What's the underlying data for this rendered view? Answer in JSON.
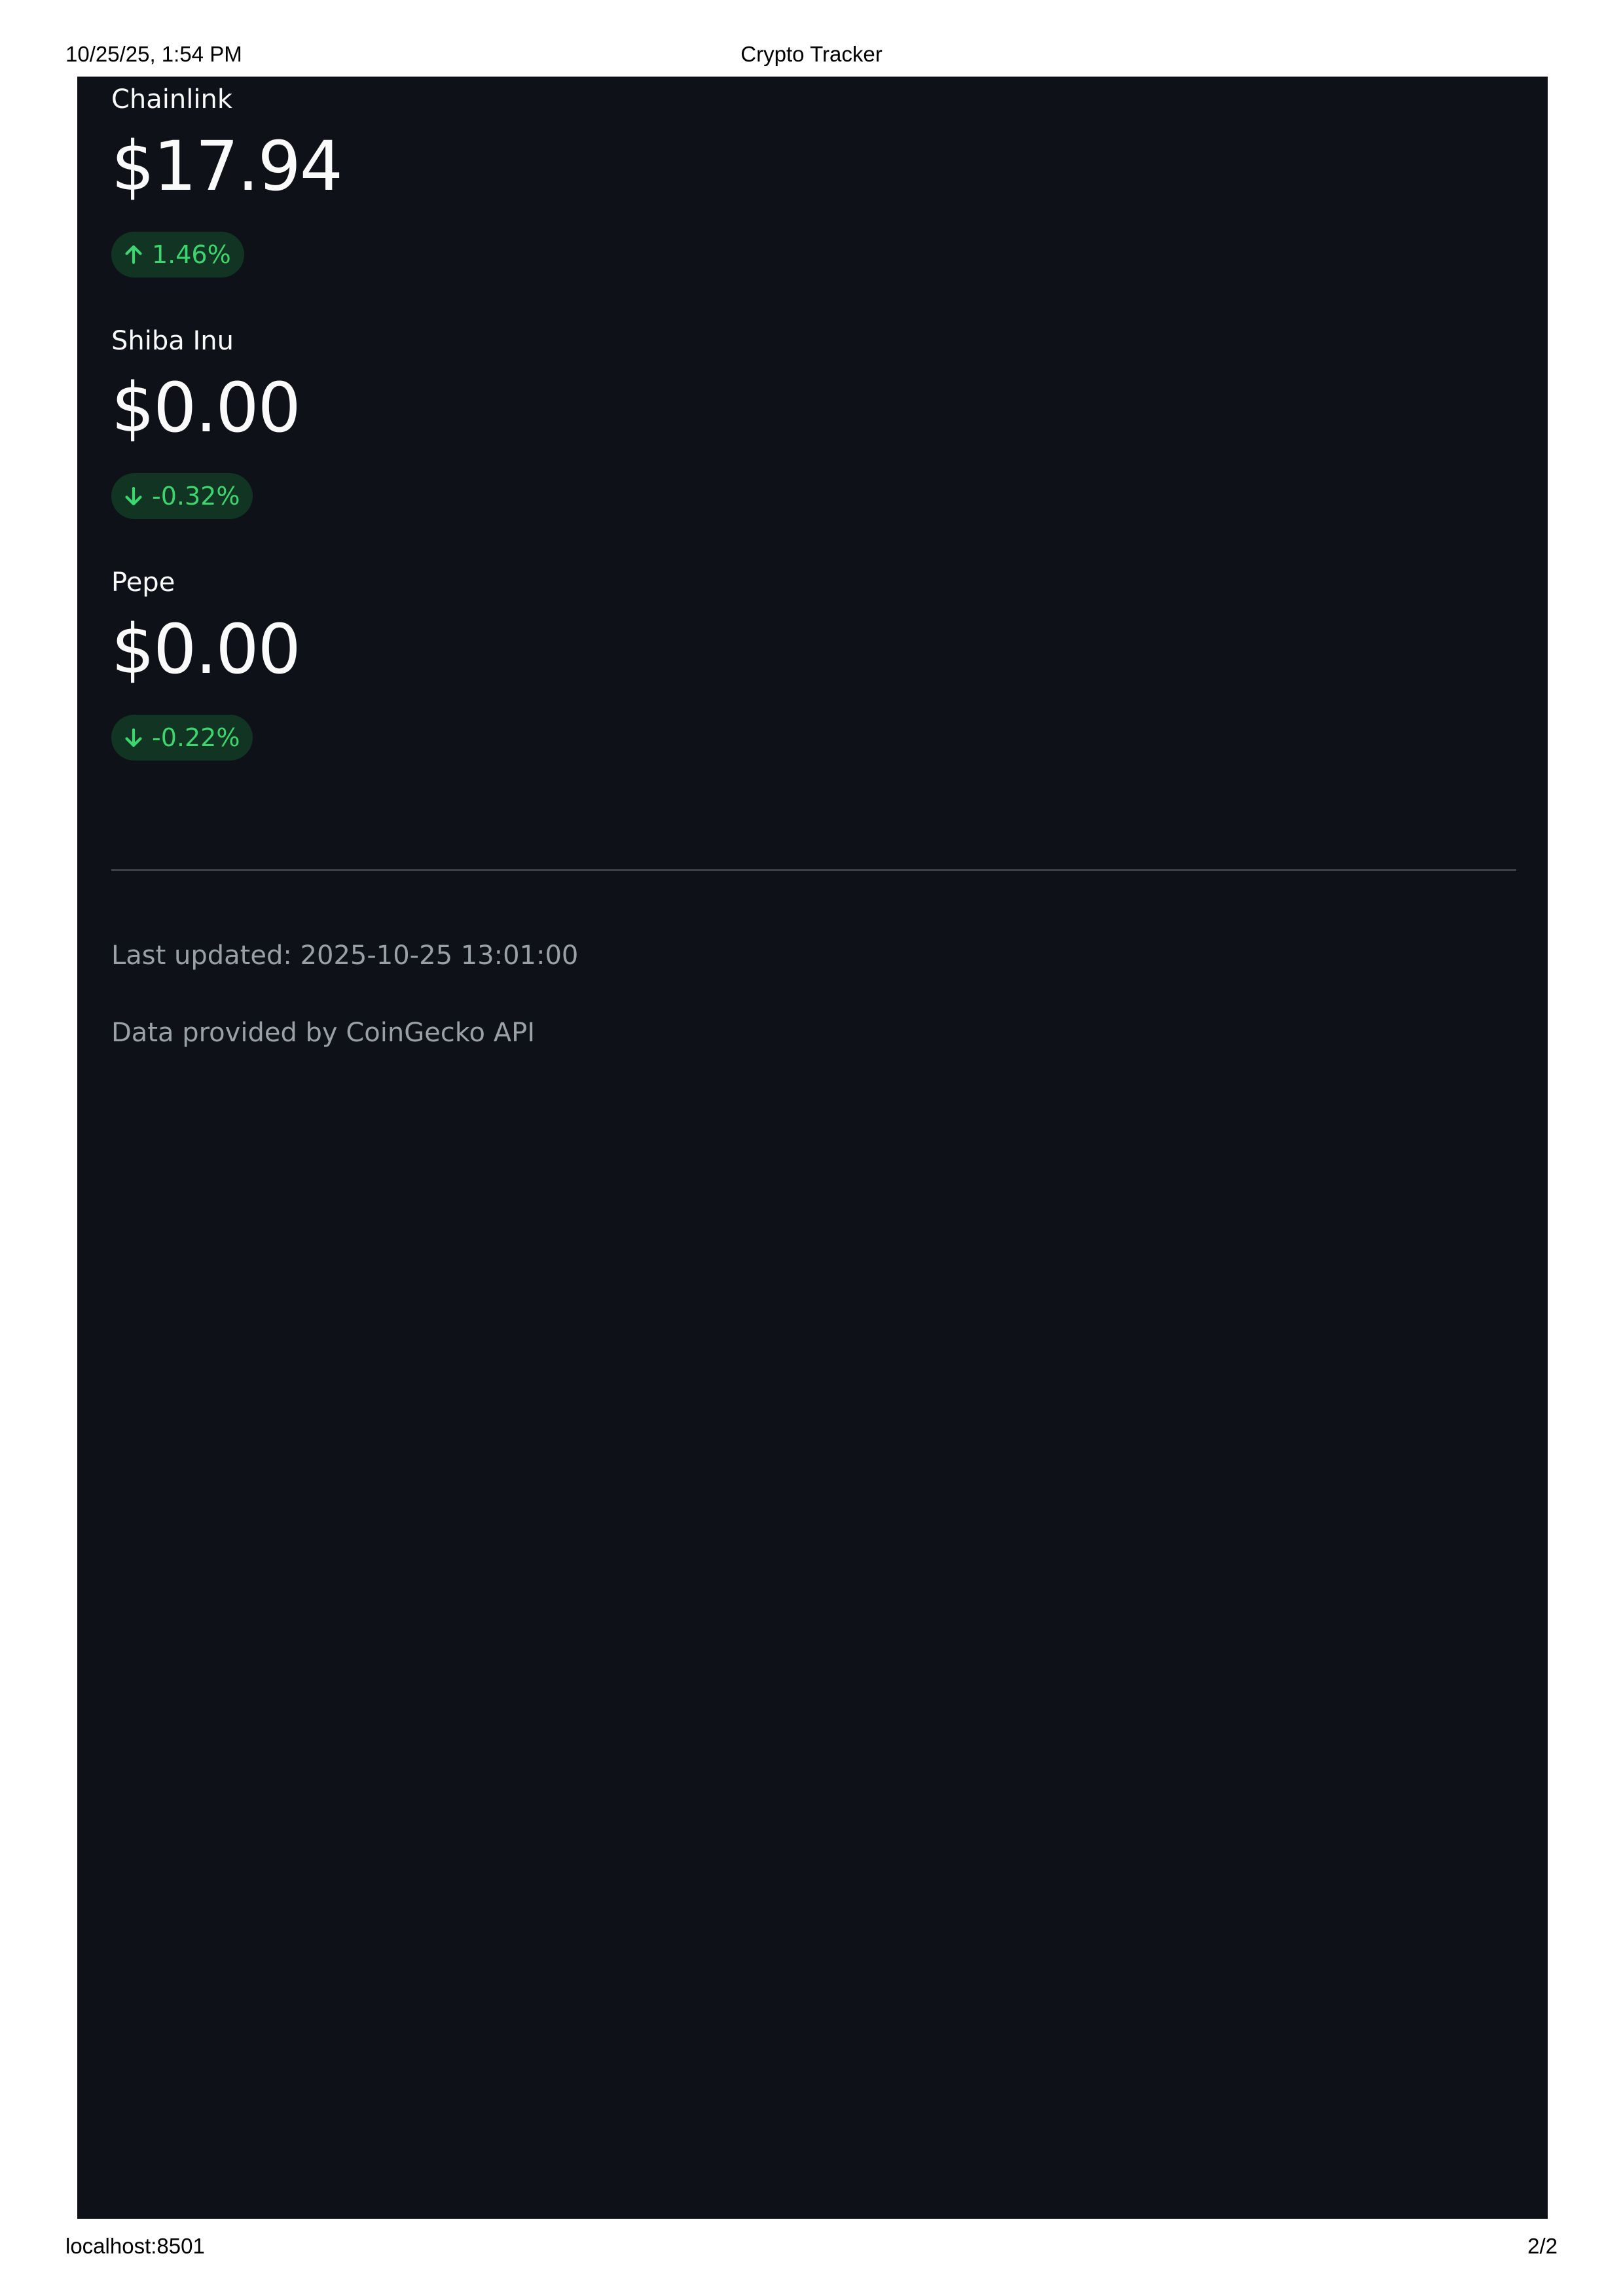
{
  "print_header": {
    "datetime": "10/25/25, 1:54 PM",
    "title": "Crypto Tracker"
  },
  "print_footer": {
    "url": "localhost:8501",
    "page": "2/2"
  },
  "metrics": [
    {
      "name": "Chainlink",
      "price": "$17.94",
      "delta": "1.46%",
      "direction": "up",
      "delta_icon": "arrow-up-icon"
    },
    {
      "name": "Shiba Inu",
      "price": "$0.00",
      "delta": "-0.32%",
      "direction": "down",
      "delta_icon": "arrow-down-icon"
    },
    {
      "name": "Pepe",
      "price": "$0.00",
      "delta": "-0.22%",
      "direction": "down",
      "delta_icon": "arrow-down-icon"
    }
  ],
  "footer": {
    "last_updated": "Last updated: 2025-10-25 13:01:00",
    "source": "Data provided by CoinGecko API"
  },
  "colors": {
    "background": "#0e1117",
    "text": "#fafafa",
    "delta_text": "#3dd56d",
    "delta_bg": "rgba(33,195,84,0.2)",
    "caption": "#9aa0a8",
    "divider": "#3e4149"
  }
}
